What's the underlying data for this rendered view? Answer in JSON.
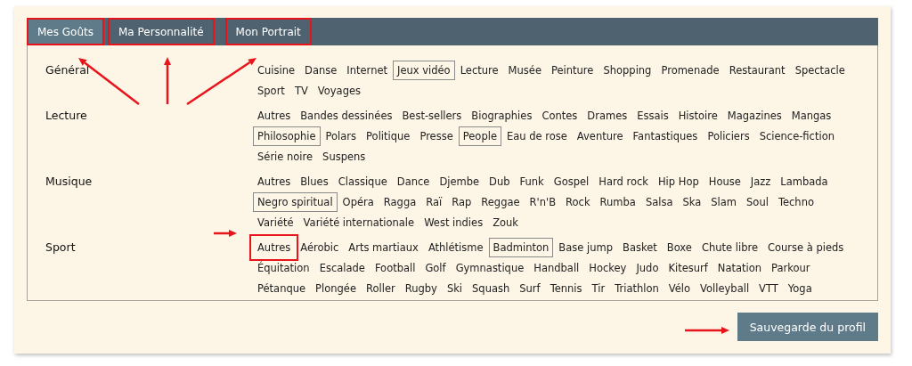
{
  "tabs": [
    {
      "label": "Mes Goûts",
      "selected": true,
      "highlighted": true,
      "arrow": true
    },
    {
      "label": "Ma Personnalité",
      "selected": false,
      "highlighted": true,
      "arrow": true
    },
    {
      "label": "Mon Portrait",
      "selected": false,
      "highlighted": true,
      "arrow": true
    }
  ],
  "categories": [
    {
      "name": "Général",
      "items": [
        {
          "label": "Cuisine",
          "selected": false
        },
        {
          "label": "Danse",
          "selected": false
        },
        {
          "label": "Internet",
          "selected": false
        },
        {
          "label": "Jeux vidéo",
          "selected": true
        },
        {
          "label": "Lecture",
          "selected": false
        },
        {
          "label": "Musée",
          "selected": false
        },
        {
          "label": "Peinture",
          "selected": false
        },
        {
          "label": "Shopping",
          "selected": false
        },
        {
          "label": "Promenade",
          "selected": false
        },
        {
          "label": "Restaurant",
          "selected": false
        },
        {
          "label": "Spectacle",
          "selected": false
        },
        {
          "label": "Sport",
          "selected": false
        },
        {
          "label": "TV",
          "selected": false
        },
        {
          "label": "Voyages",
          "selected": false
        }
      ]
    },
    {
      "name": "Lecture",
      "items": [
        {
          "label": "Autres",
          "selected": false
        },
        {
          "label": "Bandes dessinées",
          "selected": false
        },
        {
          "label": "Best-sellers",
          "selected": false
        },
        {
          "label": "Biographies",
          "selected": false
        },
        {
          "label": "Contes",
          "selected": false
        },
        {
          "label": "Drames",
          "selected": false
        },
        {
          "label": "Essais",
          "selected": false
        },
        {
          "label": "Histoire",
          "selected": false
        },
        {
          "label": "Magazines",
          "selected": false
        },
        {
          "label": "Mangas",
          "selected": false
        },
        {
          "label": "Philosophie",
          "selected": true
        },
        {
          "label": "Polars",
          "selected": false
        },
        {
          "label": "Politique",
          "selected": false
        },
        {
          "label": "Presse",
          "selected": false
        },
        {
          "label": "People",
          "selected": true
        },
        {
          "label": "Eau de rose",
          "selected": false
        },
        {
          "label": "Aventure",
          "selected": false
        },
        {
          "label": "Fantastiques",
          "selected": false
        },
        {
          "label": "Policiers",
          "selected": false
        },
        {
          "label": "Science-fiction",
          "selected": false
        },
        {
          "label": "Série noire",
          "selected": false
        },
        {
          "label": "Suspens",
          "selected": false
        }
      ]
    },
    {
      "name": "Musique",
      "items": [
        {
          "label": "Autres",
          "selected": false
        },
        {
          "label": "Blues",
          "selected": false
        },
        {
          "label": "Classique",
          "selected": false
        },
        {
          "label": "Dance",
          "selected": false
        },
        {
          "label": "Djembe",
          "selected": false
        },
        {
          "label": "Dub",
          "selected": false
        },
        {
          "label": "Funk",
          "selected": false
        },
        {
          "label": "Gospel",
          "selected": false
        },
        {
          "label": "Hard rock",
          "selected": false
        },
        {
          "label": "Hip Hop",
          "selected": false
        },
        {
          "label": "House",
          "selected": false
        },
        {
          "label": "Jazz",
          "selected": false
        },
        {
          "label": "Lambada",
          "selected": false
        },
        {
          "label": "Negro spiritual",
          "selected": true
        },
        {
          "label": "Opéra",
          "selected": false
        },
        {
          "label": "Ragga",
          "selected": false
        },
        {
          "label": "Raï",
          "selected": false
        },
        {
          "label": "Rap",
          "selected": false
        },
        {
          "label": "Reggae",
          "selected": false
        },
        {
          "label": "R'n'B",
          "selected": false
        },
        {
          "label": "Rock",
          "selected": false
        },
        {
          "label": "Rumba",
          "selected": false
        },
        {
          "label": "Salsa",
          "selected": false
        },
        {
          "label": "Ska",
          "selected": false
        },
        {
          "label": "Slam",
          "selected": false
        },
        {
          "label": "Soul",
          "selected": false
        },
        {
          "label": "Techno",
          "selected": false
        },
        {
          "label": "Variété",
          "selected": false
        },
        {
          "label": "Variété internationale",
          "selected": false
        },
        {
          "label": "West indies",
          "selected": false
        },
        {
          "label": "Zouk",
          "selected": false
        }
      ]
    },
    {
      "name": "Sport",
      "items": [
        {
          "label": "Autres",
          "selected": false,
          "highlighted": true,
          "arrow": true
        },
        {
          "label": "Aérobic",
          "selected": false
        },
        {
          "label": "Arts martiaux",
          "selected": false
        },
        {
          "label": "Athlétisme",
          "selected": false
        },
        {
          "label": "Badminton",
          "selected": true
        },
        {
          "label": "Base jump",
          "selected": false
        },
        {
          "label": "Basket",
          "selected": false
        },
        {
          "label": "Boxe",
          "selected": false
        },
        {
          "label": "Chute libre",
          "selected": false
        },
        {
          "label": "Course à pieds",
          "selected": false
        },
        {
          "label": "Équitation",
          "selected": false
        },
        {
          "label": "Escalade",
          "selected": false
        },
        {
          "label": "Football",
          "selected": false
        },
        {
          "label": "Golf",
          "selected": false
        },
        {
          "label": "Gymnastique",
          "selected": false
        },
        {
          "label": "Handball",
          "selected": false
        },
        {
          "label": "Hockey",
          "selected": false
        },
        {
          "label": "Judo",
          "selected": false
        },
        {
          "label": "Kitesurf",
          "selected": false
        },
        {
          "label": "Natation",
          "selected": false
        },
        {
          "label": "Parkour",
          "selected": false
        },
        {
          "label": "Pétanque",
          "selected": false
        },
        {
          "label": "Plongée",
          "selected": false
        },
        {
          "label": "Roller",
          "selected": false
        },
        {
          "label": "Rugby",
          "selected": false
        },
        {
          "label": "Ski",
          "selected": false
        },
        {
          "label": "Squash",
          "selected": false
        },
        {
          "label": "Surf",
          "selected": false
        },
        {
          "label": "Tennis",
          "selected": false
        },
        {
          "label": "Tir",
          "selected": false
        },
        {
          "label": "Triathlon",
          "selected": false
        },
        {
          "label": "Vélo",
          "selected": false
        },
        {
          "label": "Volleyball",
          "selected": false
        },
        {
          "label": "VTT",
          "selected": false
        },
        {
          "label": "Yoga",
          "selected": false
        }
      ]
    }
  ],
  "save_button": {
    "label": "Sauvegarde du profil",
    "arrow": true
  }
}
